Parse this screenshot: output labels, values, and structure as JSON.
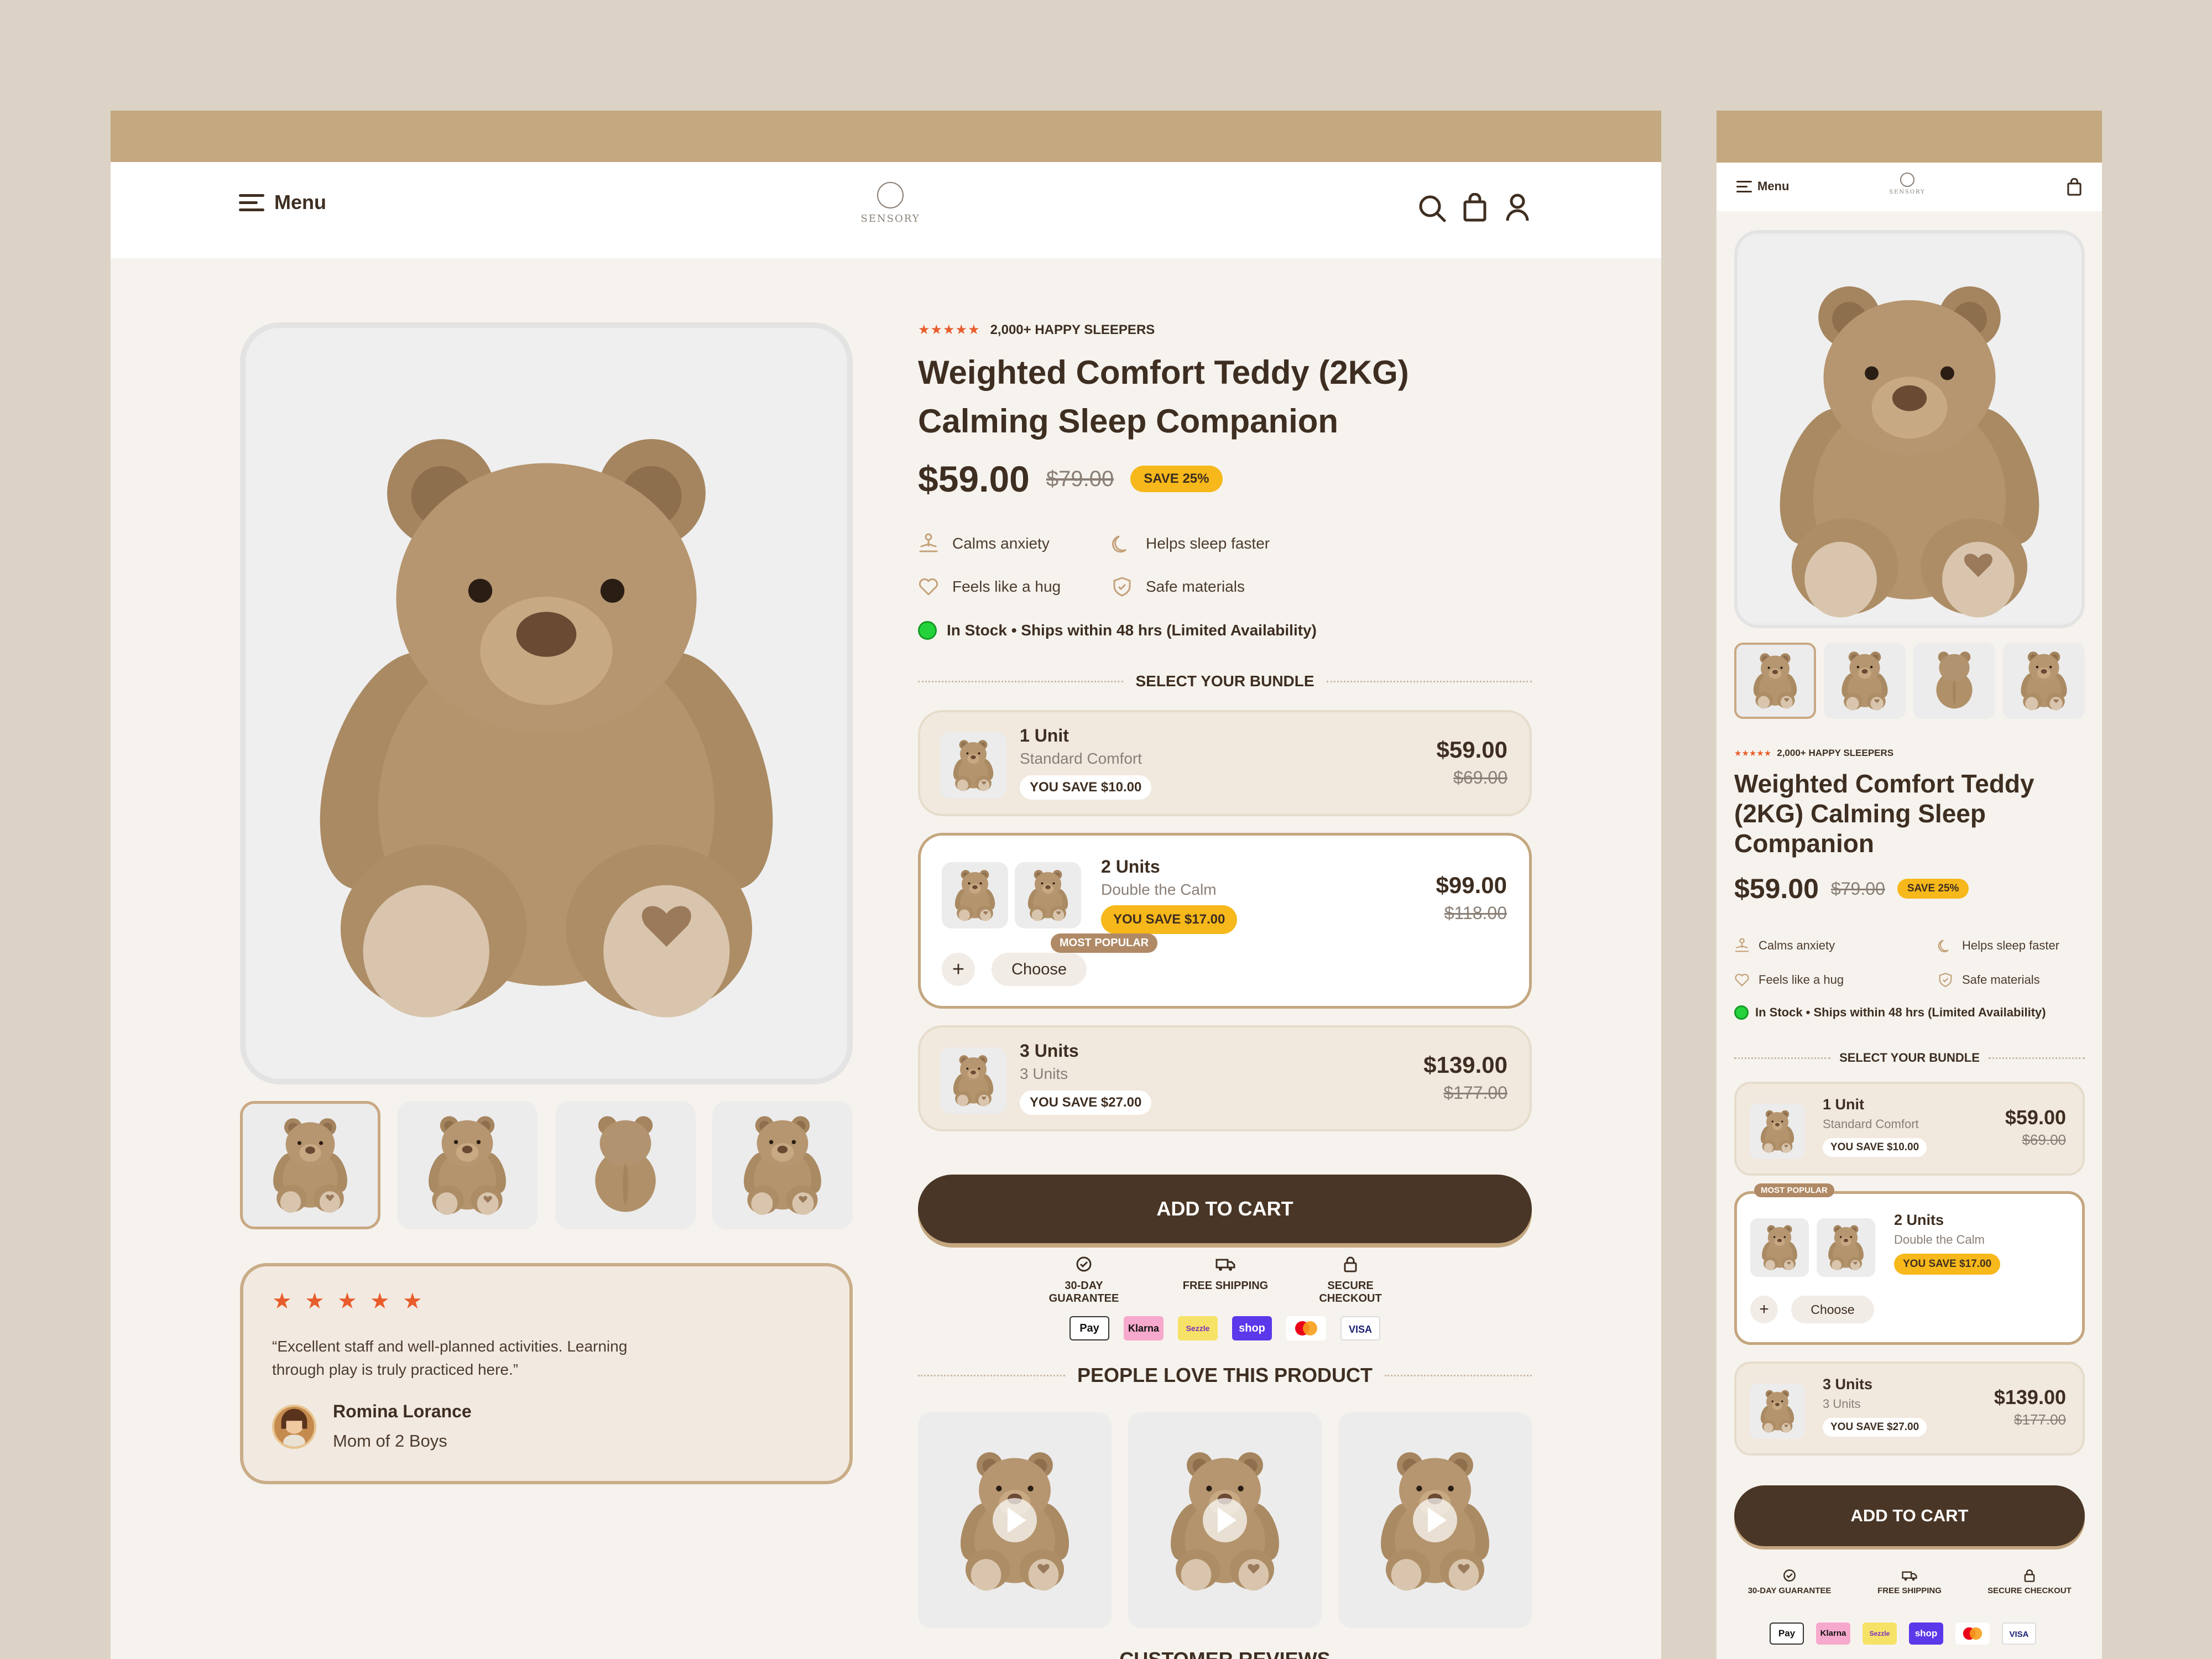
{
  "header": {
    "menu_label": "Menu",
    "logo_text": "SENSORY"
  },
  "product": {
    "rating_text": "2,000+ HAPPY SLEEPERS",
    "title_line1": "Weighted Comfort Teddy (2KG)",
    "title_line2": "Calming Sleep Companion",
    "mobile_title_line1": "Weighted Comfort Teddy",
    "mobile_title_line2": "(2KG) Calming Sleep",
    "mobile_title_line3": "Companion",
    "price": "$59.00",
    "old_price": "$79.00",
    "save_badge": "SAVE 25%",
    "features": [
      "Calms anxiety",
      "Helps sleep faster",
      "Feels like a hug",
      "Safe materials"
    ],
    "stock_text": "In Stock • Ships within 48 hrs (Limited Availability)",
    "rating": 5
  },
  "bundle": {
    "heading": "SELECT YOUR BUNDLE",
    "most_popular": "MOST POPULAR",
    "choose_label": "Choose",
    "plus_label": "+",
    "options": [
      {
        "title": "1 Unit",
        "subtitle": "Standard Comfort",
        "save": "YOU SAVE $10.00",
        "price": "$59.00",
        "old_price": "$69.00"
      },
      {
        "title": "2 Units",
        "subtitle": "Double the Calm",
        "save": "YOU SAVE $17.00",
        "price": "$99.00",
        "old_price": "$118.00"
      },
      {
        "title": "3 Units",
        "subtitle": "3 Units",
        "save": "YOU SAVE $27.00",
        "price": "$139.00",
        "old_price": "$177.00"
      }
    ]
  },
  "cart": {
    "button_label": "ADD TO CART",
    "trust": [
      "30-DAY GUARANTEE",
      "FREE SHIPPING",
      "SECURE CHECKOUT"
    ],
    "payments": [
      "Pay",
      "Klarna",
      "Sezzle",
      "shop",
      "Mastercard",
      "VISA"
    ]
  },
  "social": {
    "heading": "PEOPLE LOVE THIS PRODUCT",
    "next_heading": "CUSTOMER REVIEWS"
  },
  "review": {
    "quote_line1": "“Excellent staff and well-planned activities. Learning",
    "quote_line2": "through play is truly practiced here.”",
    "name": "Romina Lorance",
    "role": "Mom of 2 Boys",
    "stars": "★ ★ ★ ★ ★"
  },
  "colors": {
    "background": "#dcd3c6",
    "page": "#f6f3ee",
    "top_bar": "#c4a880",
    "brand_brown": "#4a3626",
    "accent_gold": "#f6b81a",
    "star_orange": "#e85d2c",
    "in_stock_green": "#24d33c"
  }
}
